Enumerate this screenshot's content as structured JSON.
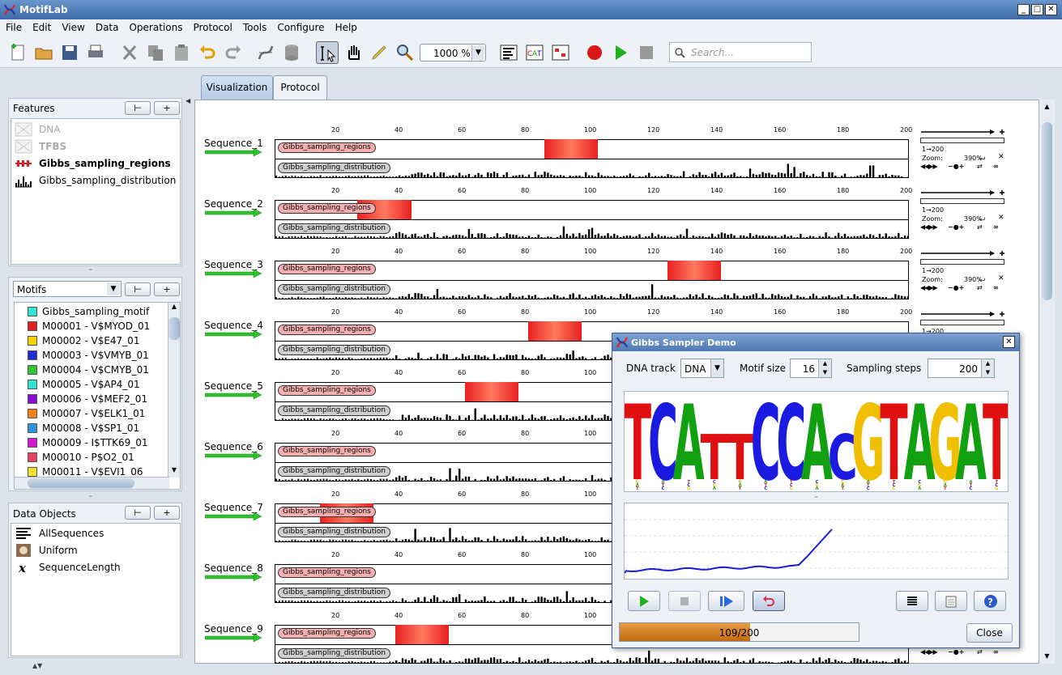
{
  "app": {
    "title": "MotifLab"
  },
  "menu": [
    "File",
    "Edit",
    "View",
    "Data",
    "Operations",
    "Protocol",
    "Tools",
    "Configure",
    "Help"
  ],
  "toolbar": {
    "zoom": "1000 %",
    "search_placeholder": "Search..."
  },
  "features": {
    "header": "Features",
    "items": [
      {
        "label": "DNA",
        "dim": true,
        "icon": "dna-track-icon"
      },
      {
        "label": "TFBS",
        "dim": true,
        "icon": "tfbs-track-icon"
      },
      {
        "label": "Gibbs_sampling_regions",
        "bold": true,
        "icon": "region-track-icon"
      },
      {
        "label": "Gibbs_sampling_distribution",
        "icon": "numeric-track-icon"
      }
    ]
  },
  "motifs": {
    "dropdown": "Motifs",
    "items": [
      {
        "label": "Gibbs_sampling_motif",
        "color": "#33e5d5"
      },
      {
        "label": "M00001 - V$MYOD_01",
        "color": "#e02020"
      },
      {
        "label": "M00002 - V$E47_01",
        "color": "#f5d300"
      },
      {
        "label": "M00003 - V$VMYB_01",
        "color": "#2030d8"
      },
      {
        "label": "M00004 - V$CMYB_01",
        "color": "#30c530"
      },
      {
        "label": "M00005 - V$AP4_01",
        "color": "#33e5d5"
      },
      {
        "label": "M00006 - V$MEF2_01",
        "color": "#8a10d8"
      },
      {
        "label": "M00007 - V$ELK1_01",
        "color": "#f08018"
      },
      {
        "label": "M00008 - V$SP1_01",
        "color": "#2a90e0"
      },
      {
        "label": "M00009 - I$TTK69_01",
        "color": "#d818d0"
      },
      {
        "label": "M00010 - P$O2_01",
        "color": "#e84060"
      },
      {
        "label": "M00011 - V$EVI1_06",
        "color": "#f5e030"
      }
    ]
  },
  "dataobjects": {
    "header": "Data Objects",
    "items": [
      {
        "label": "AllSequences",
        "icon": "sequence-collection-icon"
      },
      {
        "label": "Uniform",
        "icon": "background-model-icon"
      },
      {
        "label": "SequenceLength",
        "icon": "numeric-variable-icon"
      }
    ]
  },
  "tabs": [
    "Visualization",
    "Protocol"
  ],
  "tracks": {
    "region_label": "Gibbs_sampling_regions",
    "dist_label": "Gibbs_sampling_distribution"
  },
  "ruler_ticks": [
    "20",
    "40",
    "60",
    "80",
    "100",
    "120",
    "140",
    "160",
    "180",
    "200"
  ],
  "sequences": [
    {
      "name": "Sequence_1",
      "region": [
        86,
        102
      ]
    },
    {
      "name": "Sequence_2",
      "region": [
        27,
        43
      ]
    },
    {
      "name": "Sequence_3",
      "region": [
        125,
        141
      ]
    },
    {
      "name": "Sequence_4",
      "region": [
        81,
        97
      ]
    },
    {
      "name": "Sequence_5",
      "region": [
        61,
        77
      ]
    },
    {
      "name": "Sequence_6",
      "region": null
    },
    {
      "name": "Sequence_7",
      "region": [
        15,
        31
      ]
    },
    {
      "name": "Sequence_8",
      "region": null
    },
    {
      "name": "Sequence_9",
      "region": [
        39,
        55
      ]
    }
  ],
  "seqctrl": {
    "range": "1→200",
    "zoom_label": "Zoom:",
    "zoom": "390%"
  },
  "dialog": {
    "title": "Gibbs Sampler Demo",
    "dna_label": "DNA track",
    "dna_value": "DNA",
    "motifsize_label": "Motif size",
    "motifsize": "16",
    "steps_label": "Sampling steps",
    "steps": "200",
    "progress_text": "109/200",
    "progress": 0.545,
    "close": "Close",
    "logo": [
      [
        "T",
        "#e01010"
      ],
      [
        "C",
        "#1a1ae0"
      ],
      [
        "A",
        "#10a010"
      ],
      [
        "T",
        "#e01010"
      ],
      [
        "T",
        "#e01010"
      ],
      [
        "C",
        "#1a1ae0"
      ],
      [
        "C",
        "#1a1ae0"
      ],
      [
        "A",
        "#10a010"
      ],
      [
        "C",
        "#1a1ae0"
      ],
      [
        "G",
        "#f0c000"
      ],
      [
        "T",
        "#e01010"
      ],
      [
        "A",
        "#10a010"
      ],
      [
        "G",
        "#f0c000"
      ],
      [
        "A",
        "#10a010"
      ],
      [
        "T",
        "#e01010"
      ]
    ]
  }
}
